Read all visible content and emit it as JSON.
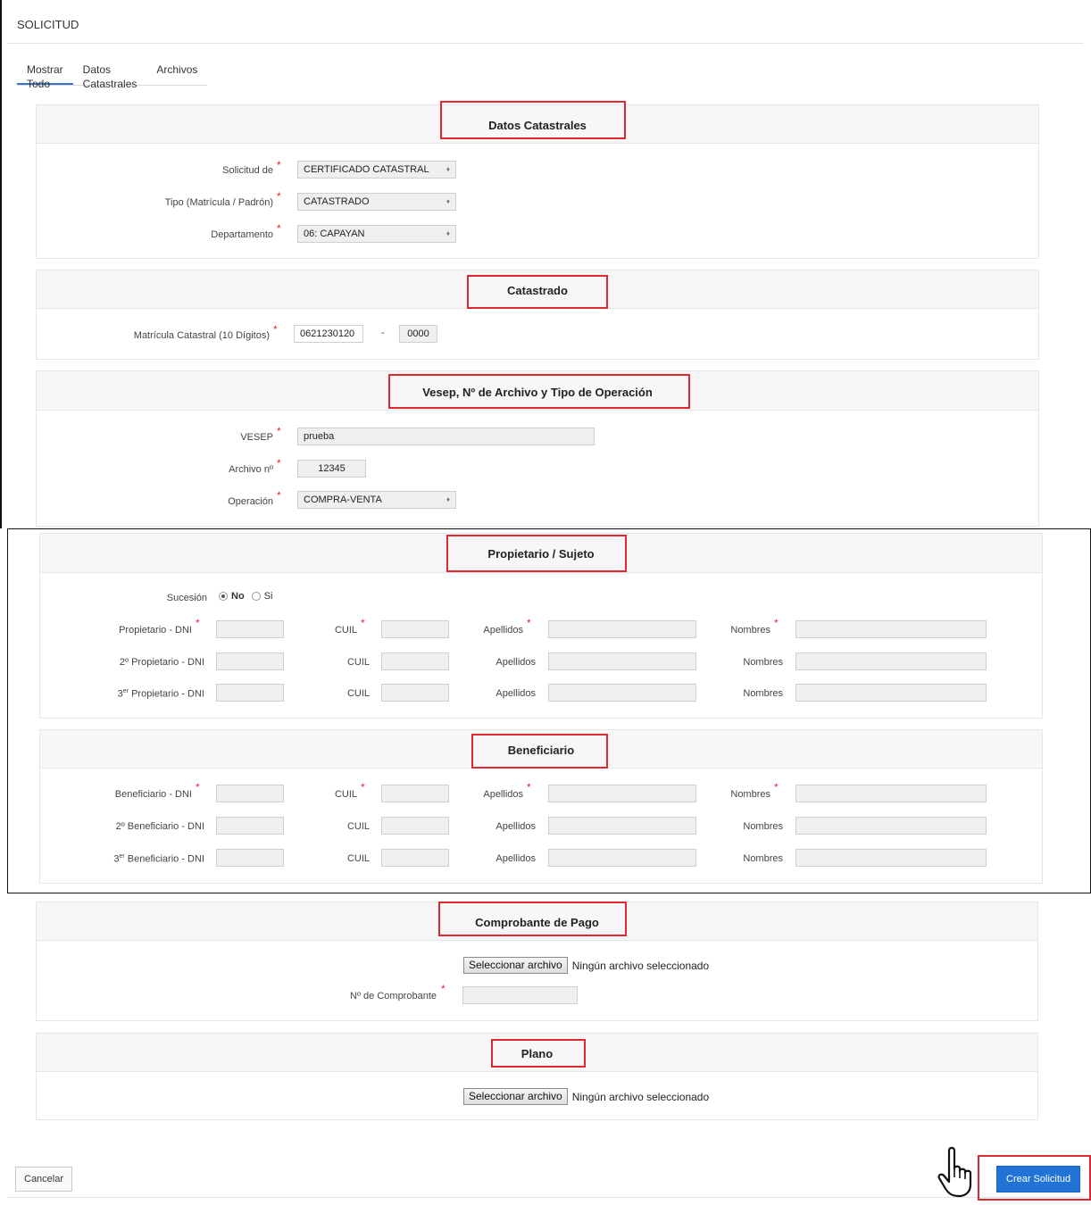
{
  "page": {
    "title": "SOLICITUD"
  },
  "tabs": [
    {
      "label": "Mostrar Todo"
    },
    {
      "label": "Datos Catastrales"
    },
    {
      "label": "Archivos"
    }
  ],
  "datos_catastrales": {
    "title": "Datos Catastrales",
    "solicitud_label": "Solicitud de",
    "solicitud_value": "CERTIFICADO CATASTRAL",
    "tipo_label": "Tipo (Matrícula / Padrón)",
    "tipo_value": "CATASTRADO",
    "departamento_label": "Departamento",
    "departamento_value": "06: CAPAYAN"
  },
  "catastrado": {
    "title": "Catastrado",
    "matricula_label": "Matrícula Catastral (10 Dígitos)",
    "matricula_value": "0621230120",
    "separator": "-",
    "sub_value": "0000"
  },
  "vesep": {
    "title": "Vesep, Nº de Archivo y Tipo de Operación",
    "vesep_label": "VESEP",
    "vesep_value": "prueba",
    "archivo_label": "Archivo nº",
    "archivo_value": "12345",
    "operacion_label": "Operación",
    "operacion_value": "COMPRA-VENTA"
  },
  "propietario": {
    "title": "Propietario / Sujeto",
    "sucesion_label": "Sucesión",
    "sucesion_no": "No",
    "sucesion_si": "Si",
    "row1_label": "Propietario - DNI",
    "row2_label": "2º Propietario - DNI",
    "row3_prefix": "3",
    "row3_sup": "er",
    "row3_label": " Propietario - DNI"
  },
  "beneficiario": {
    "title": "Beneficiario",
    "row1_label": "Beneficiario - DNI",
    "row2_label": "2º Beneficiario - DNI",
    "row3_prefix": "3",
    "row3_sup": "er",
    "row3_label": " Beneficiario - DNI"
  },
  "common": {
    "cuil_label": "CUIL",
    "apellidos_label": "Apellidos",
    "nombres_label": "Nombres",
    "required_mark": "*"
  },
  "comprobante": {
    "title": "Comprobante de Pago",
    "file_button": "Seleccionar archivo",
    "file_status": "Ningún archivo seleccionado",
    "numero_label": "Nº de Comprobante"
  },
  "plano": {
    "title": "Plano",
    "file_button": "Seleccionar archivo",
    "file_status": "Ningún archivo seleccionado"
  },
  "actions": {
    "cancel": "Cancelar",
    "create": "Crear Solicitud"
  },
  "colors": {
    "primary": "#2173d6",
    "highlight": "#e0282e",
    "required": "#e0282e",
    "tab_active": "#3a73c8"
  }
}
